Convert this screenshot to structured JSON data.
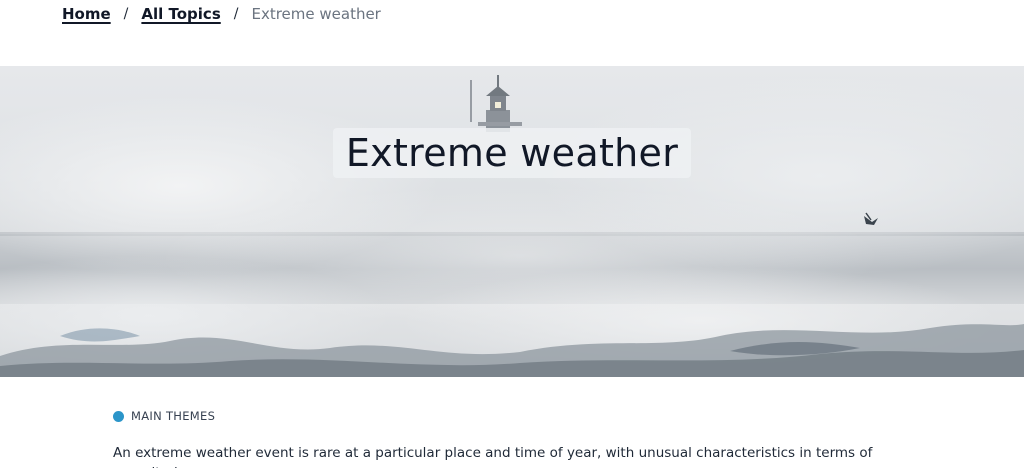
{
  "breadcrumb": {
    "items": [
      {
        "label": "Home"
      },
      {
        "label": "All Topics"
      }
    ],
    "separator": "/",
    "current": "Extreme weather"
  },
  "hero": {
    "title": "Extreme weather"
  },
  "section": {
    "label": "MAIN THEMES",
    "dot_color": "#2b95c9"
  },
  "intro": {
    "line1": "An extreme weather event is rare at a particular place and time of year, with unusual characteristics in terms of magnitude,"
  }
}
